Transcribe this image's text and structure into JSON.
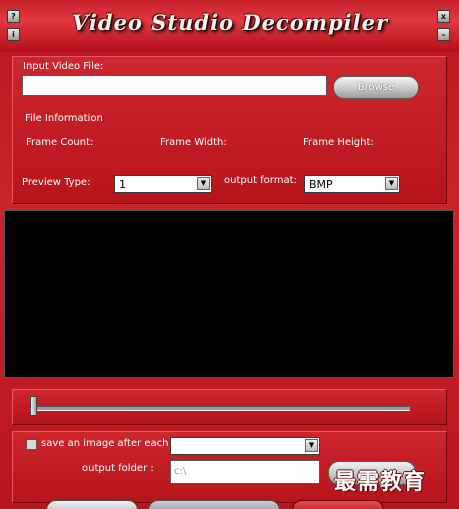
{
  "window": {
    "title": "Video Studio Decompiler",
    "help_glyph": "?",
    "info_glyph": "i",
    "close_glyph": "x",
    "minimize_glyph": "–"
  },
  "input_section": {
    "label": "Input Video File:",
    "value": "",
    "browse_label": "Browse"
  },
  "file_info": {
    "heading": "File Information",
    "frame_count_label": "Frame Count:",
    "frame_width_label": "Frame Width:",
    "frame_height_label": "Frame Height:"
  },
  "options": {
    "preview_type_label": "Preview Type:",
    "preview_type_value": "1",
    "output_format_label": "output format:",
    "output_format_value": "BMP"
  },
  "slider": {
    "position": 0
  },
  "save_section": {
    "save_label": "save an image after each :",
    "save_checked": false,
    "save_interval_value": "",
    "output_folder_label": "output folder :",
    "output_folder_value": "c:\\"
  },
  "watermark": "最需教育",
  "colors": {
    "accent": "#c8242b",
    "preview": "#000000"
  }
}
